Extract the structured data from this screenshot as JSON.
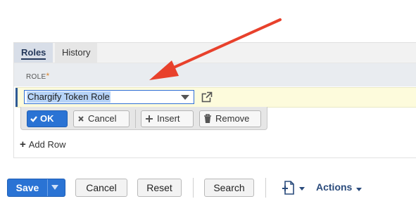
{
  "tabs": [
    {
      "label": "Roles",
      "active": true
    },
    {
      "label": "History",
      "active": false
    }
  ],
  "table": {
    "column_header": "ROLE",
    "required_marker": "*"
  },
  "edit_row": {
    "role_value": "Chargify Token Role"
  },
  "row_buttons": {
    "ok": "OK",
    "cancel": "Cancel",
    "insert": "Insert",
    "remove": "Remove"
  },
  "add_row_label": "Add Row",
  "footer": {
    "save": "Save",
    "cancel": "Cancel",
    "reset": "Reset",
    "search": "Search",
    "actions": "Actions"
  },
  "colors": {
    "primary_blue": "#2a73d4",
    "annotation_arrow": "#e8412c",
    "edit_row_bg": "#fdfbdc"
  },
  "icons": [
    "external-link-icon",
    "check-icon",
    "x-icon",
    "plus-icon",
    "trash-icon",
    "new-document-icon",
    "caret-down-icon"
  ]
}
